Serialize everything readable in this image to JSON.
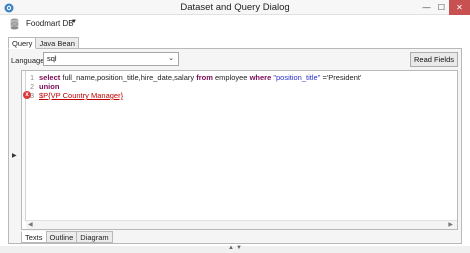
{
  "window": {
    "title": "Dataset and Query Dialog",
    "minimize_glyph": "—",
    "maximize_glyph": "☐",
    "close_glyph": "✕"
  },
  "datasource": {
    "name": "Foodmart DB",
    "dropdown_glyph": "▼"
  },
  "tabs": [
    {
      "label": "Query",
      "active": true
    },
    {
      "label": "Java Bean",
      "active": false
    }
  ],
  "language": {
    "label": "Language",
    "selected": "sql",
    "caret": "⌄"
  },
  "read_fields_label": "Read Fields",
  "editor": {
    "lines": [
      {
        "number": "1",
        "kw1": "select",
        "text1": " full_name,position_title,hire_date,salary ",
        "kw2": "from",
        "text2": " employee ",
        "kw3": "where",
        "text3": " ",
        "str1": "\"position_title\"",
        "text4": " ='President'"
      },
      {
        "number": "2",
        "kw1": "union"
      },
      {
        "number": "3",
        "err_text": "$P{VP Country Manager}",
        "has_error": true
      }
    ],
    "error_glyph": "x"
  },
  "bottom_tabs": [
    {
      "label": "Texts",
      "active": true
    },
    {
      "label": "Outline",
      "active": false
    },
    {
      "label": "Diagram",
      "active": false
    }
  ],
  "icons": {
    "app": "app-icon",
    "database": "database-icon",
    "error": "error-icon"
  },
  "colors": {
    "keyword": "#7a0b55",
    "string": "#2a2fc7",
    "error": "#c00000",
    "close_button": "#c75050"
  }
}
